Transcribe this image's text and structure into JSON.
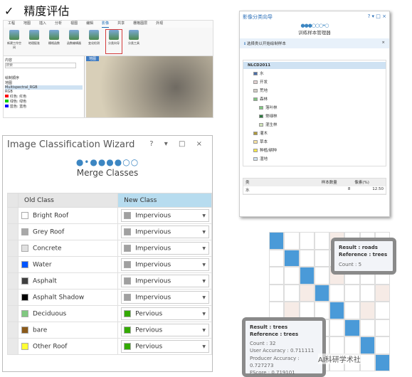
{
  "title": {
    "check": "✓",
    "text": "精度评估"
  },
  "ribbon": {
    "tabs": [
      "工程",
      "地图",
      "插入",
      "分析",
      "视图",
      "编辑",
      "影像",
      "共享",
      "栅格图层",
      "外观"
    ],
    "active_tab": "影像",
    "tools": [
      "新建工作空间",
      "地理配准",
      "栅格函数",
      "函数编辑器",
      "变化检测",
      "分类向导",
      "分类工具"
    ],
    "highlighted_tool": "分类向导",
    "pane_title": "内容",
    "search_placeholder": "搜索",
    "drawing_order": "绘制顺序",
    "map_layer": "地图",
    "raster_layer": "Multispectral_RGB",
    "band_label": "RGB",
    "bands": [
      {
        "label": "红色: 红色",
        "color": "#ff0000"
      },
      {
        "label": "绿色: 绿色",
        "color": "#00cc00"
      },
      {
        "label": "蓝色: 蓝色",
        "color": "#0000ff"
      }
    ],
    "map_tab": "地图"
  },
  "sample_manager": {
    "title": "影像分类向导",
    "controls": "? ▾ □ ×",
    "steps": "●●●○○○•○",
    "subtitle": "训练样本管理器",
    "info": "选择类以开始绘制样本",
    "root": "NLCD2011",
    "classes": [
      {
        "label": "水",
        "color": "#4a6ea8",
        "level": 1
      },
      {
        "label": "开发",
        "color": "#e2cfcf",
        "level": 1
      },
      {
        "label": "荒地",
        "color": "#d3ccc5",
        "level": 1
      },
      {
        "label": "森林",
        "color": "#7fc47f",
        "level": 1
      },
      {
        "label": "落叶林",
        "color": "#80c880",
        "level": 2
      },
      {
        "label": "常绿林",
        "color": "#2e7a40",
        "level": 2
      },
      {
        "label": "混生林",
        "color": "#cfe3b8",
        "level": 2
      },
      {
        "label": "灌木",
        "color": "#b09a3c",
        "level": 1
      },
      {
        "label": "草本",
        "color": "#f7e2a0",
        "level": 1
      },
      {
        "label": "种植/耕种",
        "color": "#f5e84a",
        "level": 1
      },
      {
        "label": "湿地",
        "color": "#cfe3f3",
        "level": 1
      }
    ],
    "table": {
      "headers": [
        "类",
        "样本数量",
        "像素(%)"
      ],
      "rows": [
        [
          "水",
          "8",
          "12.50"
        ]
      ]
    }
  },
  "wizard": {
    "title": "Image Classification Wizard",
    "controls": "? ▾ □ ×",
    "steps": "●•●●●●○○",
    "subtitle": "Merge Classes",
    "headers": [
      "Old Class",
      "New Class"
    ],
    "rows": [
      {
        "old": "Bright Roof",
        "old_color": "#ffffff",
        "new": "Impervious",
        "new_color": "#a0a0a0"
      },
      {
        "old": "Grey Roof",
        "old_color": "#a8a8a8",
        "new": "Impervious",
        "new_color": "#a0a0a0"
      },
      {
        "old": "Concrete",
        "old_color": "#e0e0e0",
        "new": "Impervious",
        "new_color": "#a0a0a0"
      },
      {
        "old": "Water",
        "old_color": "#0055ff",
        "new": "Impervious",
        "new_color": "#a0a0a0"
      },
      {
        "old": "Asphalt",
        "old_color": "#404040",
        "new": "Impervious",
        "new_color": "#a0a0a0"
      },
      {
        "old": "Asphalt Shadow",
        "old_color": "#000000",
        "new": "Impervious",
        "new_color": "#a0a0a0"
      },
      {
        "old": "Deciduous",
        "old_color": "#80c880",
        "new": "Pervious",
        "new_color": "#33aa00"
      },
      {
        "old": "bare",
        "old_color": "#8b5a1a",
        "new": "Pervious",
        "new_color": "#33aa00"
      },
      {
        "old": "Other Roof",
        "old_color": "#ffff33",
        "new": "Pervious",
        "new_color": "#33aa00"
      }
    ]
  },
  "matrix": {
    "diag_color": "#4a9ad8",
    "off_color": "#f6ebe6",
    "tooltip1": {
      "result": "Result : roads",
      "reference": "Reference : trees",
      "count": "Count : 5"
    },
    "tooltip2": {
      "result": "Result : trees",
      "reference": "Reference : trees",
      "count": "Count : 32",
      "ua": "User Accuracy : 0.711111",
      "pa": "Producer Accuracy : 0.727273",
      "fs": "FScore : 0.719101"
    }
  },
  "watermark": "AI科研学术社"
}
